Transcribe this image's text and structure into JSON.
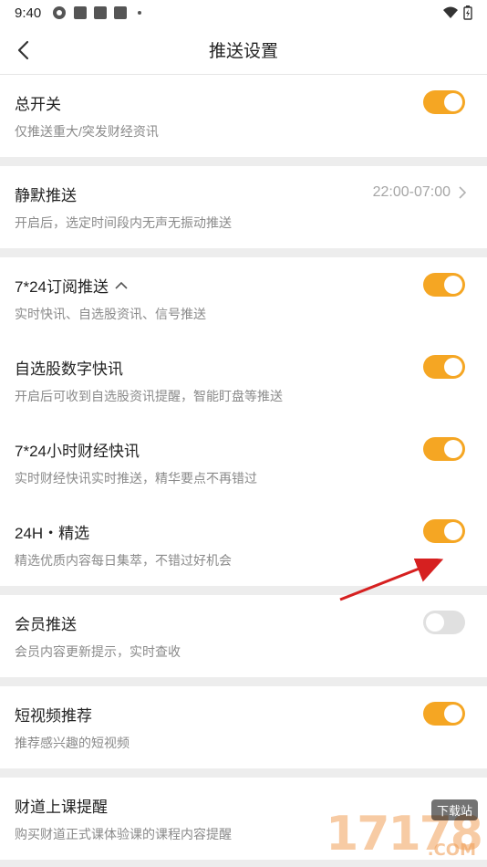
{
  "status": {
    "time": "9:40"
  },
  "nav": {
    "title": "推送设置"
  },
  "groups": [
    [
      {
        "title": "总开关",
        "subtitle": "仅推送重大/突发财经资讯",
        "toggle": "on"
      }
    ],
    [
      {
        "title": "静默推送",
        "subtitle": "开启后，选定时间段内无声无振动推送",
        "value": "22:00-07:00"
      }
    ],
    [
      {
        "title": "7*24订阅推送",
        "subtitle": "实时快讯、自选股资讯、信号推送",
        "toggle": "on",
        "expanded": true
      },
      {
        "title": "自选股数字快讯",
        "subtitle": "开启后可收到自选股资讯提醒，智能盯盘等推送",
        "toggle": "on"
      },
      {
        "title": "7*24小时财经快讯",
        "subtitle": "实时财经快讯实时推送，精华要点不再错过",
        "toggle": "on"
      },
      {
        "title": "24H・精选",
        "subtitle": "精选优质内容每日集萃，不错过好机会",
        "toggle": "on"
      }
    ],
    [
      {
        "title": "会员推送",
        "subtitle": "会员内容更新提示，实时查收",
        "toggle": "off"
      }
    ],
    [
      {
        "title": "短视频推荐",
        "subtitle": "推荐感兴趣的短视频",
        "toggle": "on"
      }
    ],
    [
      {
        "title": "财道上课提醒",
        "subtitle": "购买财道正式课体验课的课程内容提醒"
      }
    ]
  ],
  "watermark": {
    "number": "17178",
    "badge": "下载站",
    "domain": ".COM"
  },
  "colors": {
    "accent": "#f5a623",
    "arrow": "#d62020"
  }
}
